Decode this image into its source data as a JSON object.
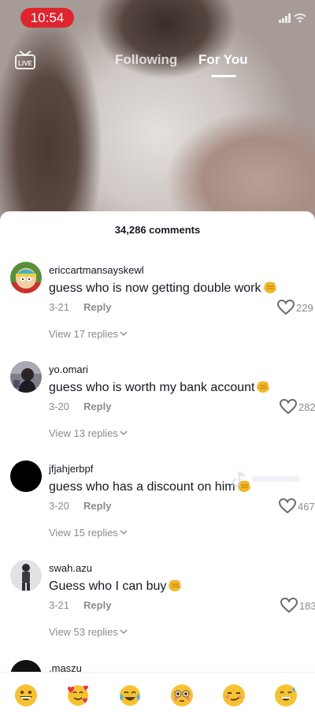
{
  "status_bar": {
    "time": "10:54"
  },
  "feed": {
    "tabs": [
      {
        "label": "Following"
      },
      {
        "label": "For You"
      }
    ]
  },
  "comments_sheet": {
    "title": "34,286 comments",
    "comments": [
      {
        "username": "ericcartmansayskewl",
        "text": "guess who is now getting double work",
        "date": "3-21",
        "reply_label": "Reply",
        "likes": "229",
        "view_replies": "View 17 replies"
      },
      {
        "username": "yo.omari",
        "text": "guess who is worth my bank account",
        "date": "3-20",
        "reply_label": "Reply",
        "likes": "282",
        "view_replies": "View 13 replies"
      },
      {
        "username": "jfjahjerbpf",
        "text": "guess who has a discount on him",
        "date": "3-20",
        "reply_label": "Reply",
        "likes": "467",
        "view_replies": "View 15 replies"
      },
      {
        "username": "swah.azu",
        "text": "Guess who I can buy",
        "date": "3-21",
        "reply_label": "Reply",
        "likes": "183",
        "view_replies": "View 53 replies"
      },
      {
        "username": ".maszu"
      }
    ]
  },
  "colors": {
    "status_pill": "#e0242f",
    "text_primary": "#161823",
    "text_secondary": "#8a8b91"
  },
  "emoji_bar": {
    "icons": [
      "grinning-emoji-icon",
      "smiling-hearts-emoji-icon",
      "tears-of-joy-emoji-icon",
      "flushed-emoji-icon",
      "smirk-emoji-icon",
      "sweat-smile-emoji-icon"
    ]
  }
}
